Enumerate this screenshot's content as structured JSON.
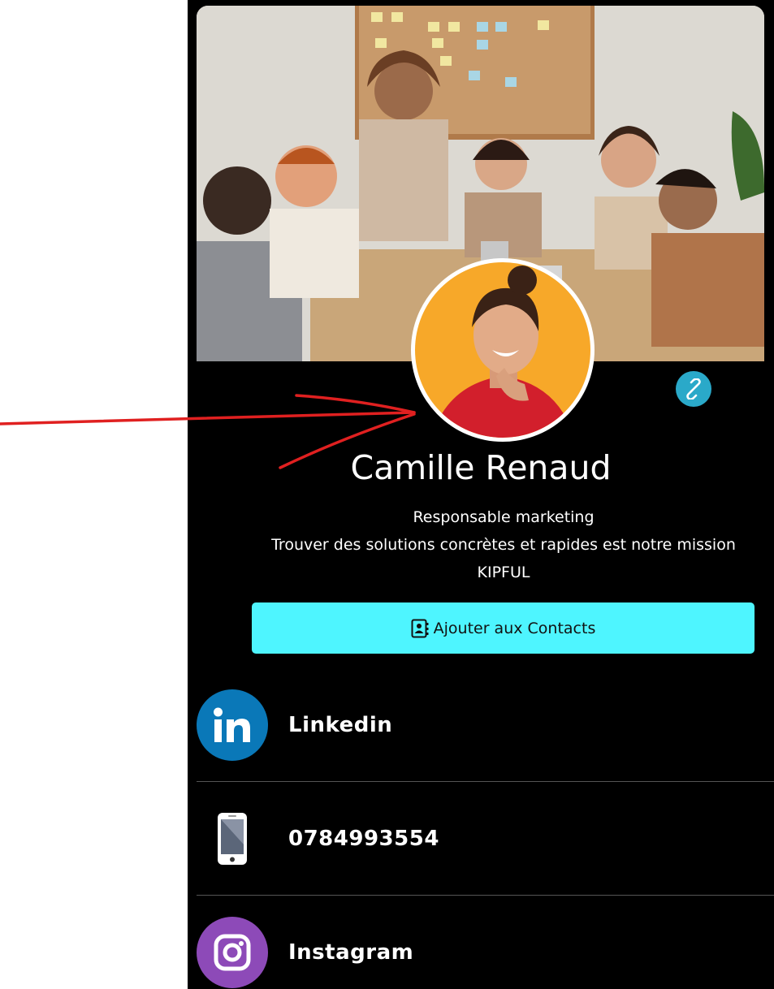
{
  "profile": {
    "name": "Camille Renaud",
    "job_title": "Responsable marketing",
    "tagline": "Trouver des solutions concrètes et rapides est notre mission",
    "company": "KIPFUL"
  },
  "actions": {
    "add_contact_label": "Ajouter aux Contacts"
  },
  "links": [
    {
      "label": "Linkedin",
      "icon": "linkedin-icon",
      "color": "#0a78b8"
    },
    {
      "label": "0784993554",
      "icon": "phone-icon"
    },
    {
      "label": "Instagram",
      "icon": "instagram-icon",
      "color": "#8d4ab8"
    }
  ],
  "colors": {
    "background": "#000000",
    "button": "#4ef5ff",
    "link_badge": "#2aa9c9",
    "annotation_arrow": "#e02020"
  }
}
